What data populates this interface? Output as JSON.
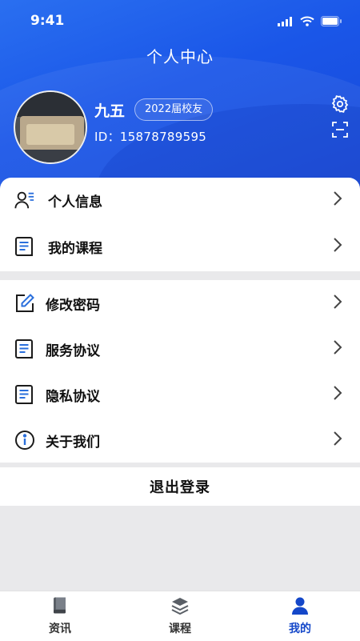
{
  "status": {
    "time": "9:41"
  },
  "header": {
    "title": "个人中心",
    "user": {
      "name": "九五",
      "badge": "2022届校友",
      "id": "ID：15878789595"
    },
    "icons": [
      "settings-icon",
      "scan-icon"
    ]
  },
  "menu_group1": [
    {
      "label": "个人信息",
      "icon": "user-list-icon"
    },
    {
      "label": "我的课程",
      "icon": "document-icon"
    }
  ],
  "menu_group2": [
    {
      "label": "修改密码",
      "icon": "edit-icon"
    },
    {
      "label": "服务协议",
      "icon": "document-icon"
    },
    {
      "label": "隐私协议",
      "icon": "document-icon"
    },
    {
      "label": "关于我们",
      "icon": "info-icon"
    }
  ],
  "logout_label": "退出登录",
  "tabs": [
    {
      "label": "资讯",
      "icon": "book-icon",
      "active": false
    },
    {
      "label": "课程",
      "icon": "layers-icon",
      "active": false
    },
    {
      "label": "我的",
      "icon": "person-icon",
      "active": true
    }
  ],
  "colors": {
    "primary": "#1a56e8",
    "accent_dark": "#1447c9",
    "icon_blue": "#2a6fdc"
  }
}
